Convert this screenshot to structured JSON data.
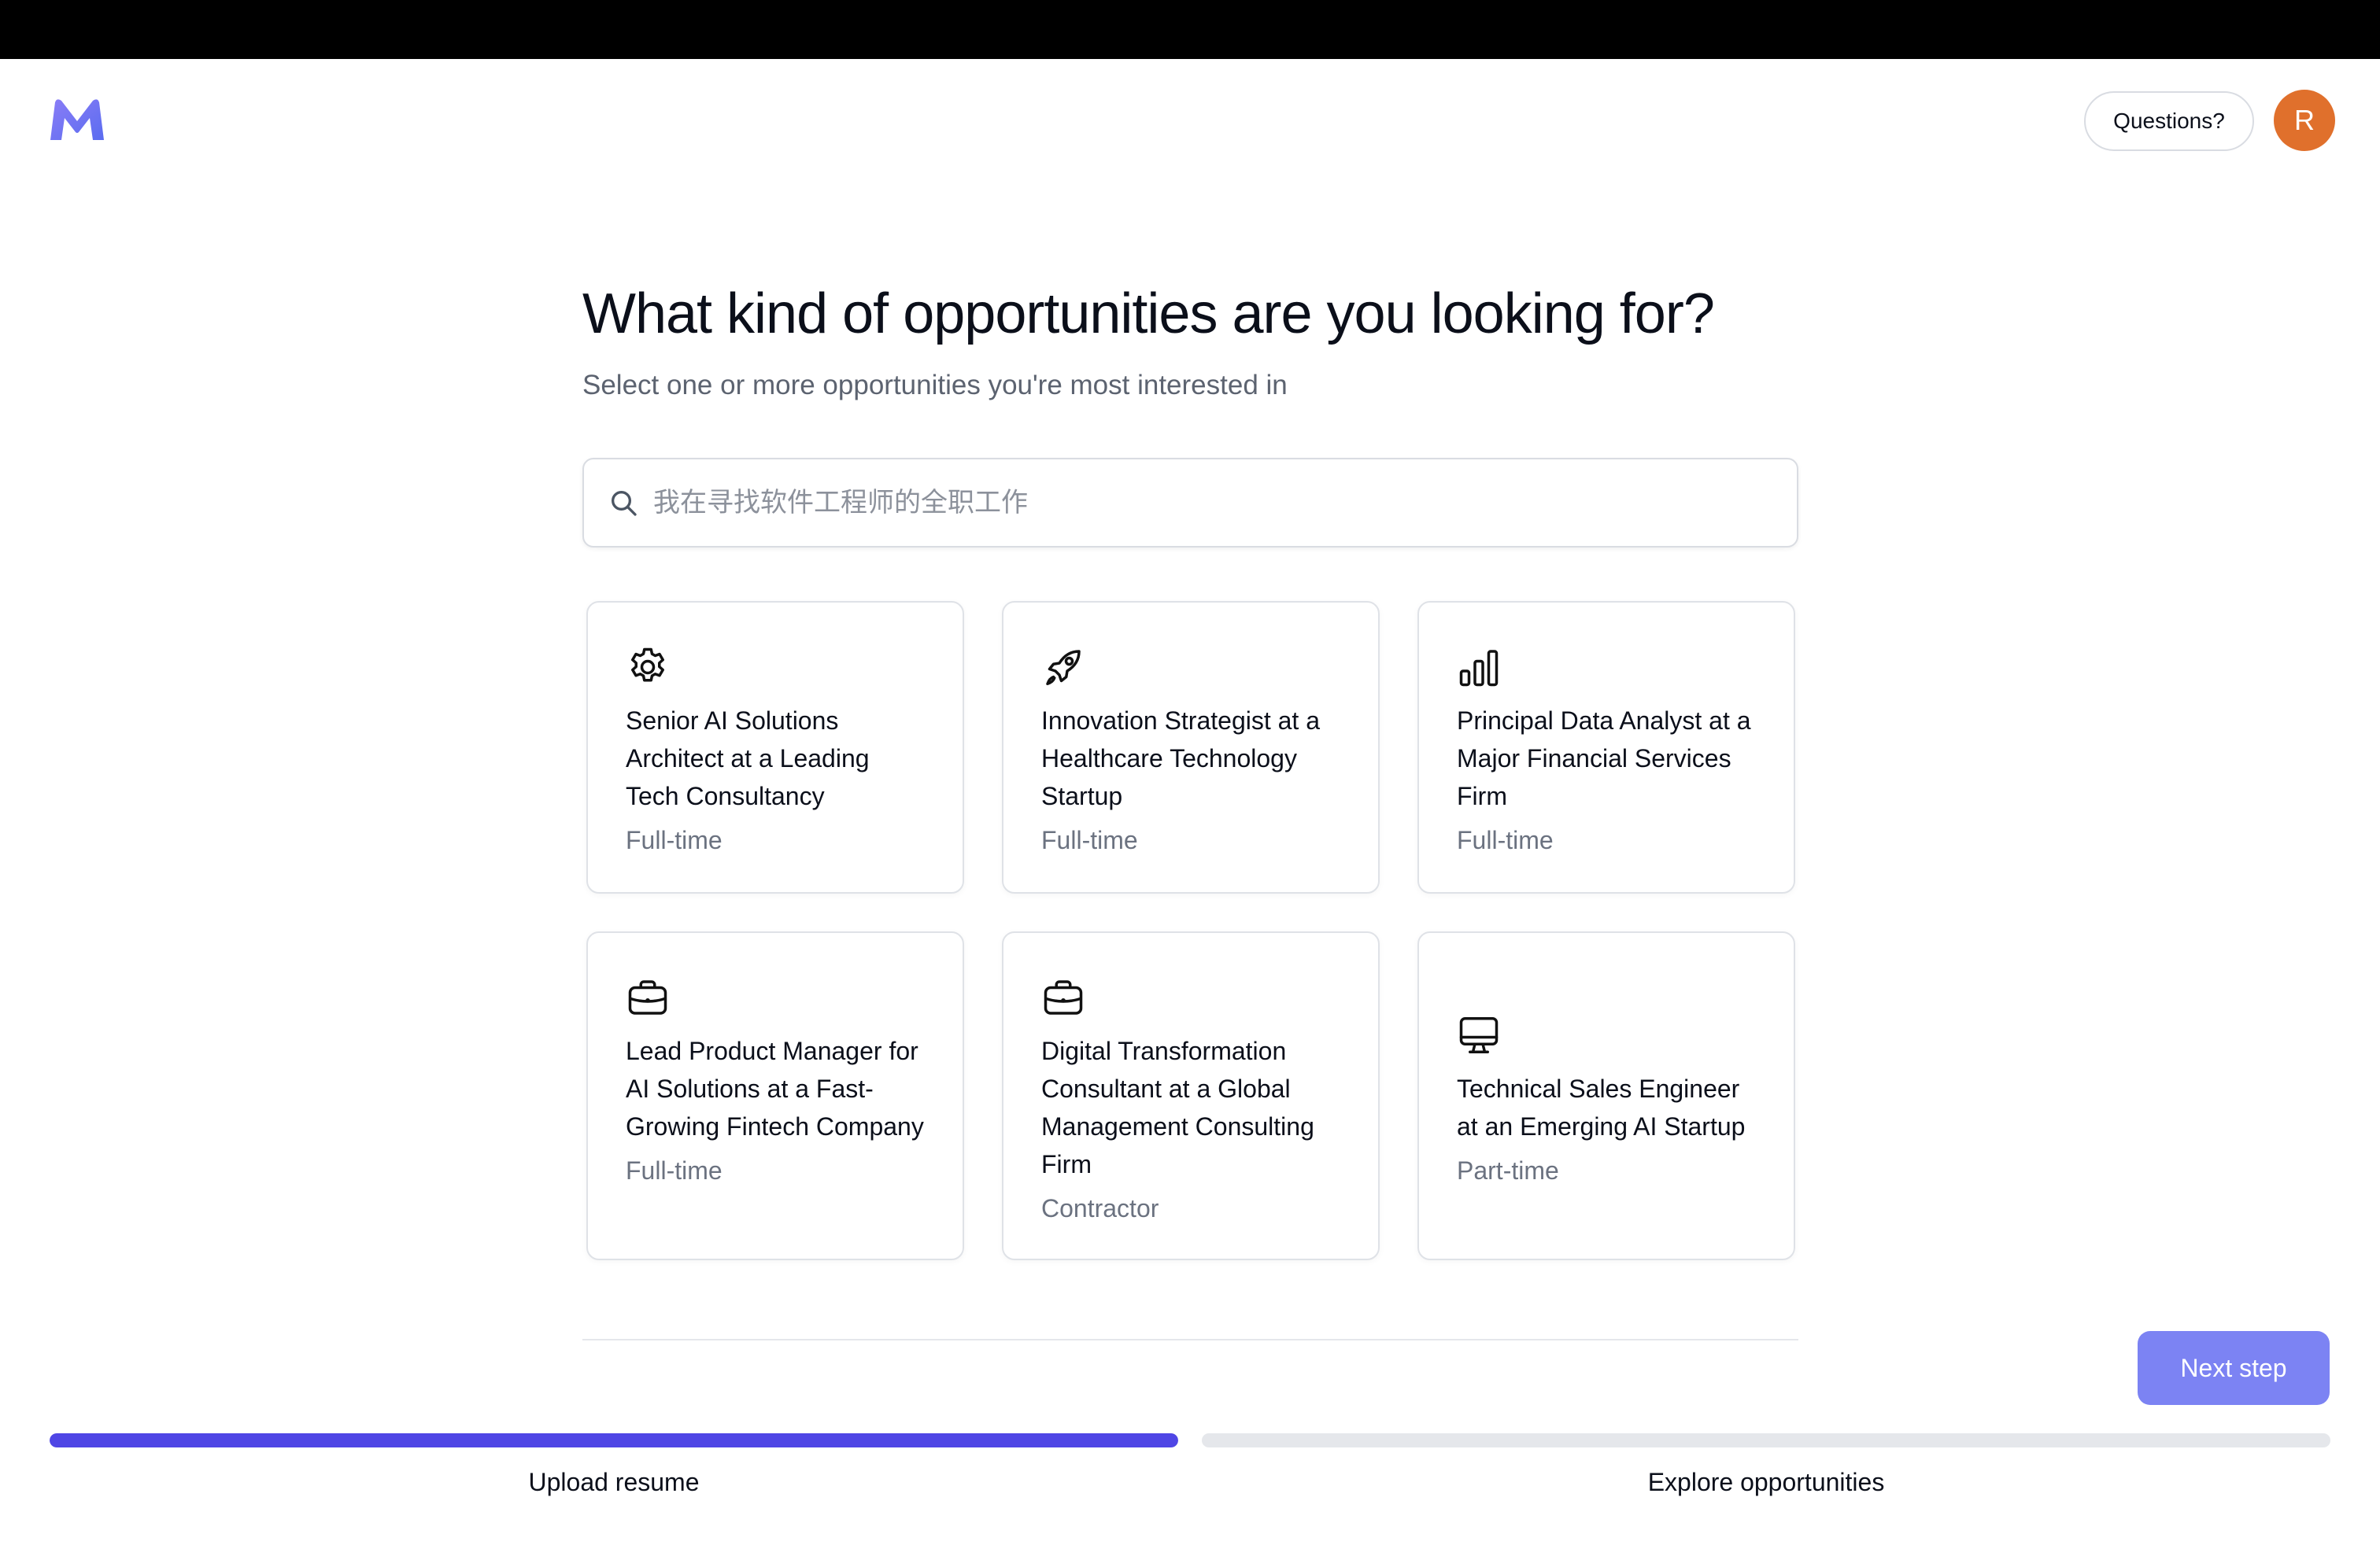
{
  "header": {
    "logo_icon": "m-logo-icon",
    "questions_label": "Questions?",
    "avatar_initial": "R",
    "avatar_color": "#e0702c"
  },
  "main": {
    "title": "What kind of opportunities are you looking for?",
    "subtitle": "Select one or more opportunities you're most interested in",
    "search": {
      "placeholder": "我在寻找软件工程师的全职工作",
      "value": "",
      "icon": "search-icon"
    },
    "cards": [
      {
        "icon": "gear-icon",
        "title": "Senior AI Solutions Architect at a Leading Tech Consultancy",
        "type": "Full-time"
      },
      {
        "icon": "rocket-icon",
        "title": "Innovation Strategist at a Healthcare Technology Startup",
        "type": "Full-time"
      },
      {
        "icon": "bar-chart-icon",
        "title": "Principal Data Analyst at a Major Financial Services Firm",
        "type": "Full-time"
      },
      {
        "icon": "briefcase-icon",
        "title": "Lead Product Manager for AI Solutions at a Fast-Growing Fintech Company",
        "type": "Full-time"
      },
      {
        "icon": "briefcase-icon",
        "title": "Digital Transformation Consultant at a Global Management Consulting Firm",
        "type": "Contractor"
      },
      {
        "icon": "monitor-icon",
        "title": "Technical Sales Engineer at an Emerging AI Startup",
        "type": "Part-time"
      }
    ]
  },
  "footer": {
    "next_label": "Next step",
    "next_color": "#7c83f3",
    "accent_color": "#4f46e5",
    "steps": [
      {
        "label": "Upload resume",
        "progress": 1.0
      },
      {
        "label": "Explore opportunities",
        "progress": 0.0
      }
    ]
  }
}
